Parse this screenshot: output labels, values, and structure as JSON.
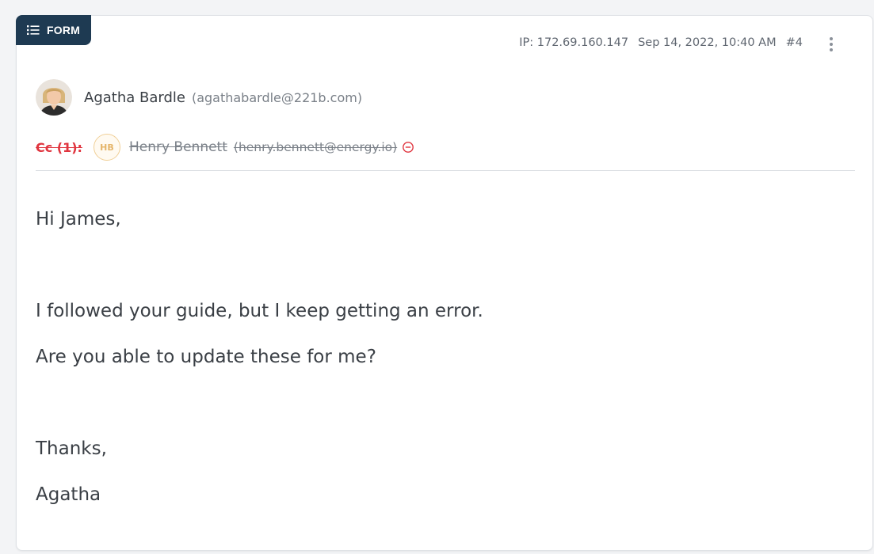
{
  "badge": {
    "icon": "list-icon",
    "label": "FORM",
    "color": "#1e3a52"
  },
  "meta": {
    "ip": "IP: 172.69.160.147",
    "datetime": "Sep 14, 2022, 10:40 AM",
    "number": "#4",
    "menu_icon": "kebab-menu-icon"
  },
  "sender": {
    "name": "Agatha Bardle",
    "email": "(agathabardle@221b.com)"
  },
  "cc": {
    "label": "Cc (1):",
    "initials": "HB",
    "name": "Henry Bennett",
    "email": "(henry.bennett@energy.io)",
    "remove_icon": "minus-circle-icon"
  },
  "message": {
    "greeting": "Hi James,",
    "blank_1": "",
    "line_1": "I followed your guide, but I keep getting an error.",
    "line_2": "Are you able to update these for me?",
    "blank_2": "",
    "closing": "Thanks,",
    "signature": "Agatha"
  },
  "colors": {
    "accent": "#1e3a52",
    "cc_red": "#e0353f",
    "cc_avatar": "#e5b56a"
  }
}
